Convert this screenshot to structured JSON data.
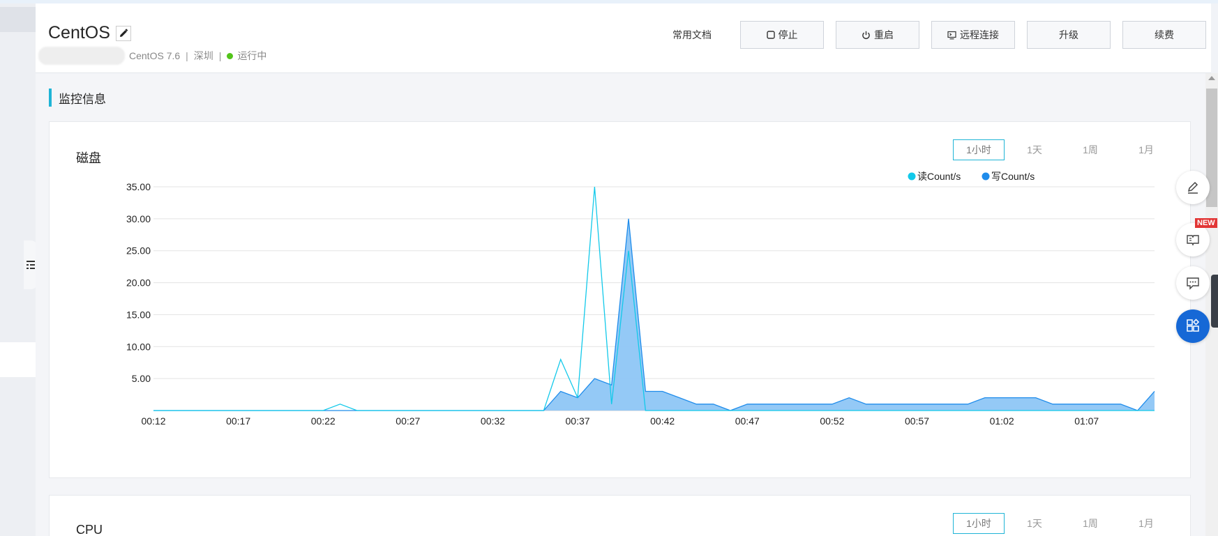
{
  "instance": {
    "name": "CentOS",
    "os": "CentOS 7.6",
    "region": "深圳",
    "status": "运行中",
    "status_color": "#52c41a"
  },
  "toolbar": {
    "docs_label": "常用文档",
    "buttons": [
      {
        "label": "停止",
        "icon": "stop-icon"
      },
      {
        "label": "重启",
        "icon": "power-icon"
      },
      {
        "label": "远程连接",
        "icon": "remote-desktop-icon"
      },
      {
        "label": "升级",
        "icon": ""
      },
      {
        "label": "续费",
        "icon": ""
      }
    ]
  },
  "section": {
    "title": "监控信息",
    "accent": "#1fb4d6"
  },
  "disk_card": {
    "title": "磁盘",
    "ranges": [
      "1小时",
      "1天",
      "1周",
      "1月"
    ],
    "active_range": "1小时"
  },
  "cpu_card": {
    "title": "CPU",
    "ranges": [
      "1小时",
      "1天",
      "1周",
      "1月"
    ],
    "active_range": "1小时"
  },
  "floating_toolbar": [
    {
      "icon": "edit-icon"
    },
    {
      "icon": "manual-icon",
      "badge": "NEW"
    },
    {
      "icon": "chat-icon"
    },
    {
      "icon": "apps-icon"
    }
  ],
  "chart_data": {
    "type": "area",
    "title": "",
    "xlabel": "",
    "ylabel": "",
    "ylim": [
      0,
      35
    ],
    "yticks": [
      "35.00",
      "30.00",
      "25.00",
      "20.00",
      "15.00",
      "10.00",
      "5.00"
    ],
    "xticks": [
      "00:12",
      "00:17",
      "00:22",
      "00:27",
      "00:32",
      "00:37",
      "00:42",
      "00:47",
      "00:52",
      "00:57",
      "01:02",
      "01:07"
    ],
    "legend_position": "top-right",
    "grid": true,
    "series": [
      {
        "name": "读Count/s",
        "color": "#12c9ea",
        "style": "line",
        "points": [
          [
            "00:12",
            0
          ],
          [
            "00:22",
            0
          ],
          [
            "00:23",
            1
          ],
          [
            "00:24",
            0
          ],
          [
            "00:35",
            0
          ],
          [
            "00:36",
            8
          ],
          [
            "00:37",
            2
          ],
          [
            "00:38",
            35
          ],
          [
            "00:39",
            1
          ],
          [
            "00:40",
            25
          ],
          [
            "00:41",
            0
          ],
          [
            "01:11",
            0
          ]
        ]
      },
      {
        "name": "写Count/s",
        "color": "#1f8ceb",
        "style": "area",
        "points": [
          [
            "00:12",
            0
          ],
          [
            "00:35",
            0
          ],
          [
            "00:36",
            3
          ],
          [
            "00:37",
            2
          ],
          [
            "00:38",
            5
          ],
          [
            "00:39",
            4
          ],
          [
            "00:40",
            30
          ],
          [
            "00:41",
            3
          ],
          [
            "00:42",
            3
          ],
          [
            "00:43",
            2
          ],
          [
            "00:44",
            1
          ],
          [
            "00:45",
            1
          ],
          [
            "00:46",
            0
          ],
          [
            "00:47",
            1
          ],
          [
            "00:48",
            1
          ],
          [
            "00:49",
            1
          ],
          [
            "00:50",
            1
          ],
          [
            "00:51",
            1
          ],
          [
            "00:52",
            1
          ],
          [
            "00:53",
            2
          ],
          [
            "00:54",
            1
          ],
          [
            "00:55",
            1
          ],
          [
            "00:56",
            1
          ],
          [
            "00:57",
            1
          ],
          [
            "00:58",
            1
          ],
          [
            "00:59",
            1
          ],
          [
            "01:00",
            1
          ],
          [
            "01:01",
            2
          ],
          [
            "01:02",
            2
          ],
          [
            "01:03",
            2
          ],
          [
            "01:04",
            2
          ],
          [
            "01:05",
            1
          ],
          [
            "01:06",
            1
          ],
          [
            "01:07",
            1
          ],
          [
            "01:08",
            1
          ],
          [
            "01:09",
            1
          ],
          [
            "01:10",
            0
          ],
          [
            "01:11",
            3
          ]
        ]
      }
    ]
  }
}
